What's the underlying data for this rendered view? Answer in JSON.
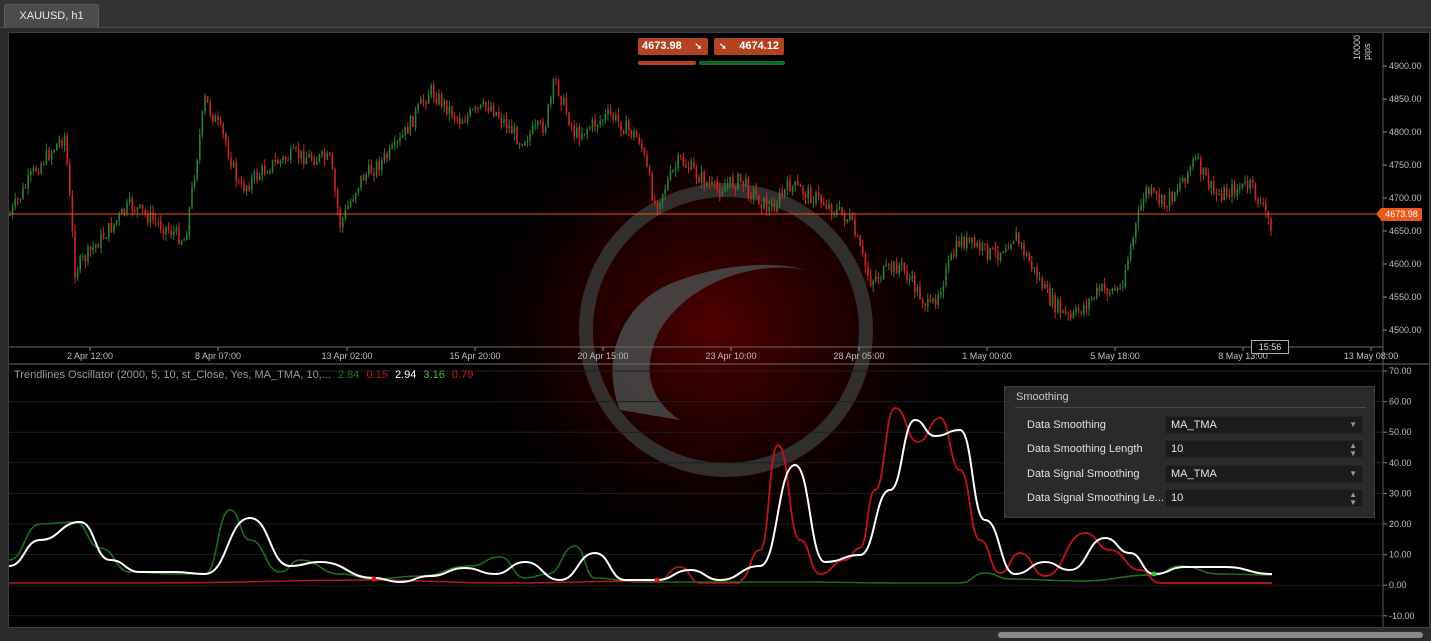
{
  "tab": {
    "label": "XAUUSD, h1"
  },
  "quotes": {
    "sell": "4673.98",
    "buy": "4674.12"
  },
  "price_axis": {
    "labels": [
      "4900.00",
      "4850.00",
      "4800.00",
      "4750.00",
      "4700.00",
      "4650.00",
      "4600.00",
      "4550.00",
      "4500.00"
    ],
    "current": "4673.98",
    "pips": "10000 pips"
  },
  "time_axis": {
    "labels": [
      "2 Apr 12:00",
      "8 Apr 07:00",
      "13 Apr 02:00",
      "15 Apr 20:00",
      "20 Apr 15:00",
      "23 Apr 10:00",
      "28 Apr 05:00",
      "1 May 00:00",
      "5 May 18:00",
      "8 May 13:00",
      "13 May 08:00"
    ],
    "countdown": "15:56"
  },
  "indicator": {
    "title": "Trendlines Oscillator (2000, 5, 10, st_Close, Yes, MA_TMA, 10,...",
    "values": [
      "2.84",
      "0.15",
      "2.94",
      "3.16",
      "0.79"
    ],
    "value_colors": [
      "#1f7a1f",
      "#c0141c",
      "#ffffff",
      "#3ec23e",
      "#e01a1a"
    ],
    "axis_labels": [
      "70.00",
      "60.00",
      "50.00",
      "40.00",
      "30.00",
      "20.00",
      "10.00",
      "0.00",
      "-10.00"
    ]
  },
  "settings": {
    "title": "Smoothing",
    "rows": [
      {
        "label": "Data Smoothing",
        "value": "MA_TMA",
        "control": "dropdown"
      },
      {
        "label": "Data Smoothing Length",
        "value": "10",
        "control": "stepper"
      },
      {
        "label": "Data Signal Smoothing",
        "value": "MA_TMA",
        "control": "dropdown"
      },
      {
        "label": "Data Signal Smoothing Le...",
        "value": "10",
        "control": "stepper"
      }
    ]
  },
  "colors": {
    "bull": "#2e7d32",
    "bear": "#c62828",
    "price_line": "#e8581c",
    "accent": "#b24220"
  }
}
